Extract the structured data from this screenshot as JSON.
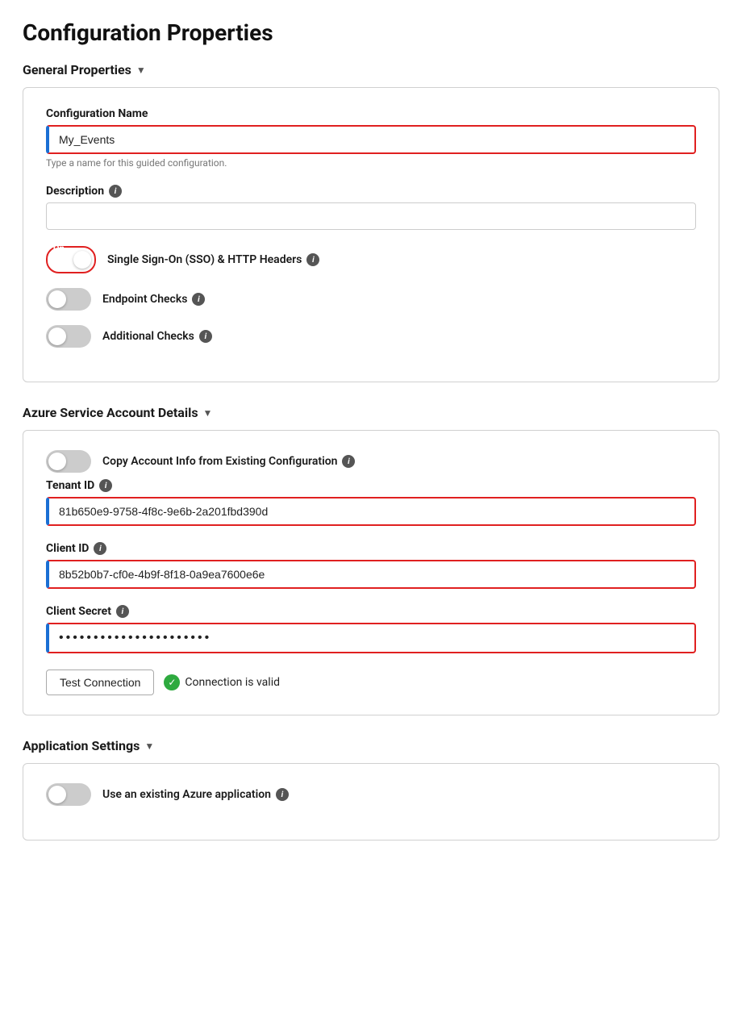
{
  "page": {
    "title": "Configuration Properties"
  },
  "generalProperties": {
    "sectionLabel": "General Properties",
    "configName": {
      "label": "Configuration Name",
      "value": "My_Events",
      "hint": "Type a name for this guided configuration."
    },
    "description": {
      "label": "Description",
      "value": ""
    },
    "sso": {
      "label": "Single Sign-On (SSO) & HTTP Headers",
      "enabled": true,
      "toggleText": "On"
    },
    "endpointChecks": {
      "label": "Endpoint Checks",
      "enabled": false
    },
    "additionalChecks": {
      "label": "Additional Checks",
      "enabled": false
    }
  },
  "azureServiceAccount": {
    "sectionLabel": "Azure Service Account Details",
    "copyAccount": {
      "label": "Copy Account Info from Existing Configuration",
      "enabled": false
    },
    "tenantId": {
      "label": "Tenant ID",
      "value": "81b650e9-9758-4f8c-9e6b-2a201fbd390d"
    },
    "clientId": {
      "label": "Client ID",
      "value": "8b52b0b7-cf0e-4b9f-8f18-0a9ea7600e6e"
    },
    "clientSecret": {
      "label": "Client Secret",
      "value": "••••••••••••••••••••••••••••"
    },
    "testButton": "Test Connection",
    "connectionStatus": "Connection is valid"
  },
  "applicationSettings": {
    "sectionLabel": "Application Settings",
    "useExisting": {
      "label": "Use an existing Azure application",
      "enabled": false
    }
  },
  "icons": {
    "info": "i",
    "chevron": "▼",
    "check": "✓"
  }
}
